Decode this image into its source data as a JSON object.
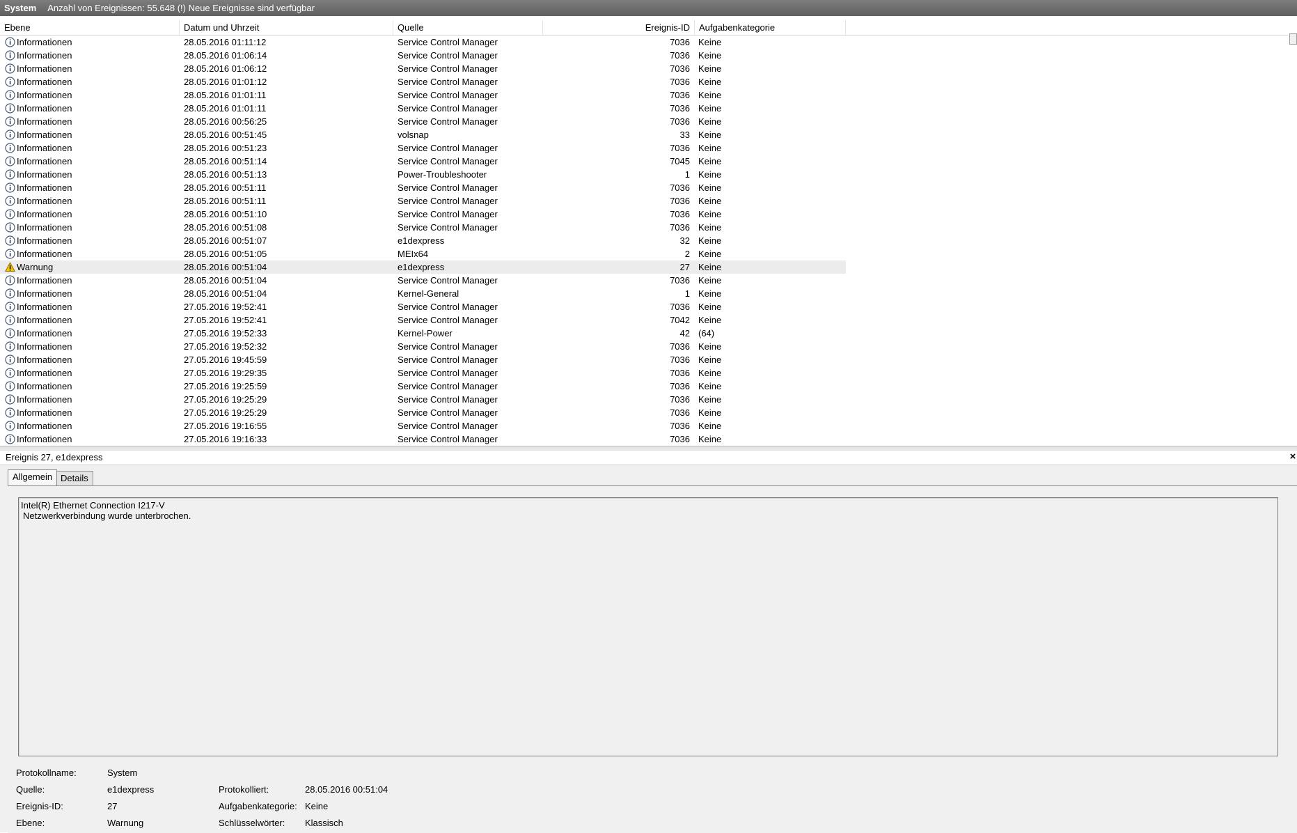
{
  "title_bar": {
    "log_name": "System",
    "info": "Anzahl von Ereignissen: 55.648 (!) Neue Ereignisse sind verfügbar"
  },
  "columns": [
    "Ebene",
    "Datum und Uhrzeit",
    "Quelle",
    "Ereignis-ID",
    "Aufgabenkategorie"
  ],
  "selected_row_index": 17,
  "rows": [
    {
      "level": "Informationen",
      "icon": "info-icon",
      "date": "28.05.2016 01:11:12",
      "source": "Service Control Manager",
      "id": "7036",
      "category": "Keine"
    },
    {
      "level": "Informationen",
      "icon": "info-icon",
      "date": "28.05.2016 01:06:14",
      "source": "Service Control Manager",
      "id": "7036",
      "category": "Keine"
    },
    {
      "level": "Informationen",
      "icon": "info-icon",
      "date": "28.05.2016 01:06:12",
      "source": "Service Control Manager",
      "id": "7036",
      "category": "Keine"
    },
    {
      "level": "Informationen",
      "icon": "info-icon",
      "date": "28.05.2016 01:01:12",
      "source": "Service Control Manager",
      "id": "7036",
      "category": "Keine"
    },
    {
      "level": "Informationen",
      "icon": "info-icon",
      "date": "28.05.2016 01:01:11",
      "source": "Service Control Manager",
      "id": "7036",
      "category": "Keine"
    },
    {
      "level": "Informationen",
      "icon": "info-icon",
      "date": "28.05.2016 01:01:11",
      "source": "Service Control Manager",
      "id": "7036",
      "category": "Keine"
    },
    {
      "level": "Informationen",
      "icon": "info-icon",
      "date": "28.05.2016 00:56:25",
      "source": "Service Control Manager",
      "id": "7036",
      "category": "Keine"
    },
    {
      "level": "Informationen",
      "icon": "info-icon",
      "date": "28.05.2016 00:51:45",
      "source": "volsnap",
      "id": "33",
      "category": "Keine"
    },
    {
      "level": "Informationen",
      "icon": "info-icon",
      "date": "28.05.2016 00:51:23",
      "source": "Service Control Manager",
      "id": "7036",
      "category": "Keine"
    },
    {
      "level": "Informationen",
      "icon": "info-icon",
      "date": "28.05.2016 00:51:14",
      "source": "Service Control Manager",
      "id": "7045",
      "category": "Keine"
    },
    {
      "level": "Informationen",
      "icon": "info-icon",
      "date": "28.05.2016 00:51:13",
      "source": "Power-Troubleshooter",
      "id": "1",
      "category": "Keine"
    },
    {
      "level": "Informationen",
      "icon": "info-icon",
      "date": "28.05.2016 00:51:11",
      "source": "Service Control Manager",
      "id": "7036",
      "category": "Keine"
    },
    {
      "level": "Informationen",
      "icon": "info-icon",
      "date": "28.05.2016 00:51:11",
      "source": "Service Control Manager",
      "id": "7036",
      "category": "Keine"
    },
    {
      "level": "Informationen",
      "icon": "info-icon",
      "date": "28.05.2016 00:51:10",
      "source": "Service Control Manager",
      "id": "7036",
      "category": "Keine"
    },
    {
      "level": "Informationen",
      "icon": "info-icon",
      "date": "28.05.2016 00:51:08",
      "source": "Service Control Manager",
      "id": "7036",
      "category": "Keine"
    },
    {
      "level": "Informationen",
      "icon": "info-icon",
      "date": "28.05.2016 00:51:07",
      "source": "e1dexpress",
      "id": "32",
      "category": "Keine"
    },
    {
      "level": "Informationen",
      "icon": "info-icon",
      "date": "28.05.2016 00:51:05",
      "source": "MEIx64",
      "id": "2",
      "category": "Keine"
    },
    {
      "level": "Warnung",
      "icon": "warning-icon",
      "date": "28.05.2016 00:51:04",
      "source": "e1dexpress",
      "id": "27",
      "category": "Keine"
    },
    {
      "level": "Informationen",
      "icon": "info-icon",
      "date": "28.05.2016 00:51:04",
      "source": "Service Control Manager",
      "id": "7036",
      "category": "Keine"
    },
    {
      "level": "Informationen",
      "icon": "info-icon",
      "date": "28.05.2016 00:51:04",
      "source": "Kernel-General",
      "id": "1",
      "category": "Keine"
    },
    {
      "level": "Informationen",
      "icon": "info-icon",
      "date": "27.05.2016 19:52:41",
      "source": "Service Control Manager",
      "id": "7036",
      "category": "Keine"
    },
    {
      "level": "Informationen",
      "icon": "info-icon",
      "date": "27.05.2016 19:52:41",
      "source": "Service Control Manager",
      "id": "7042",
      "category": "Keine"
    },
    {
      "level": "Informationen",
      "icon": "info-icon",
      "date": "27.05.2016 19:52:33",
      "source": "Kernel-Power",
      "id": "42",
      "category": "(64)"
    },
    {
      "level": "Informationen",
      "icon": "info-icon",
      "date": "27.05.2016 19:52:32",
      "source": "Service Control Manager",
      "id": "7036",
      "category": "Keine"
    },
    {
      "level": "Informationen",
      "icon": "info-icon",
      "date": "27.05.2016 19:45:59",
      "source": "Service Control Manager",
      "id": "7036",
      "category": "Keine"
    },
    {
      "level": "Informationen",
      "icon": "info-icon",
      "date": "27.05.2016 19:29:35",
      "source": "Service Control Manager",
      "id": "7036",
      "category": "Keine"
    },
    {
      "level": "Informationen",
      "icon": "info-icon",
      "date": "27.05.2016 19:25:59",
      "source": "Service Control Manager",
      "id": "7036",
      "category": "Keine"
    },
    {
      "level": "Informationen",
      "icon": "info-icon",
      "date": "27.05.2016 19:25:29",
      "source": "Service Control Manager",
      "id": "7036",
      "category": "Keine"
    },
    {
      "level": "Informationen",
      "icon": "info-icon",
      "date": "27.05.2016 19:25:29",
      "source": "Service Control Manager",
      "id": "7036",
      "category": "Keine"
    },
    {
      "level": "Informationen",
      "icon": "info-icon",
      "date": "27.05.2016 19:16:55",
      "source": "Service Control Manager",
      "id": "7036",
      "category": "Keine"
    },
    {
      "level": "Informationen",
      "icon": "info-icon",
      "date": "27.05.2016 19:16:33",
      "source": "Service Control Manager",
      "id": "7036",
      "category": "Keine"
    }
  ],
  "detail": {
    "header": "Ereignis 27, e1dexpress",
    "close_glyph": "×",
    "tabs": [
      "Allgemein",
      "Details"
    ],
    "active_tab": "Allgemein",
    "message_line1": "Intel(R) Ethernet Connection I217-V",
    "message_line2": "Netzwerkverbindung wurde unterbrochen.",
    "properties": {
      "log_name_label": "Protokollname:",
      "log_name_value": "System",
      "source_label": "Quelle:",
      "source_value": "e1dexpress",
      "logged_label": "Protokolliert:",
      "logged_value": "28.05.2016 00:51:04",
      "event_id_label": "Ereignis-ID:",
      "event_id_value": "27",
      "task_category_label": "Aufgabenkategorie:",
      "task_category_value": "Keine",
      "level_label": "Ebene:",
      "level_value": "Warnung",
      "keywords_label": "Schlüsselwörter:",
      "keywords_value": "Klassisch"
    }
  },
  "colors": {
    "title_bar_bg": "#6e6e6e",
    "selected_row_bg": "#ececec",
    "panel_bg": "#f0f0f0",
    "warning_yellow": "#f2c200"
  }
}
